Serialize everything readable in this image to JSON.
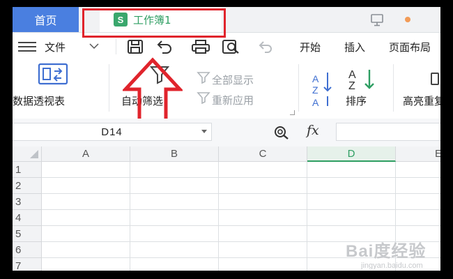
{
  "tabs": {
    "home": "首页",
    "workbook": "工作簿1",
    "workbook_badge": "S"
  },
  "menu": {
    "file": "文件",
    "items": [
      "开始",
      "插入",
      "页面布局"
    ]
  },
  "ribbon": {
    "pivot_table": "数据透视表",
    "auto_filter": "自动筛选",
    "show_all": "全部显示",
    "reapply": "重新应用",
    "sort": "排序",
    "highlight": "高亮重复项"
  },
  "formula_bar": {
    "cell_ref": "D14",
    "fx": "fx",
    "formula_value": ""
  },
  "grid": {
    "columns": [
      "A",
      "B",
      "C",
      "D",
      "E"
    ],
    "rows": [
      "1",
      "2",
      "3",
      "4",
      "5",
      "6",
      "7"
    ],
    "active_column": "D"
  },
  "watermark": {
    "main": "Bai度经验",
    "sub": "jingyan.baidu.com"
  },
  "colors": {
    "accent_green": "#2e9e62",
    "home_tab_blue": "#4a7fe0",
    "annotation_red": "#e0242c"
  },
  "icons": [
    "menu-icon",
    "chevron-down-icon",
    "save-icon",
    "undo-format-icon",
    "print-icon",
    "print-preview-icon",
    "undo-icon",
    "pivot-table-icon",
    "filter-icon",
    "show-all-filter-icon",
    "reapply-filter-icon",
    "sort-ascending-icon",
    "sort-descending-icon",
    "zoom-icon",
    "monitor-icon"
  ]
}
